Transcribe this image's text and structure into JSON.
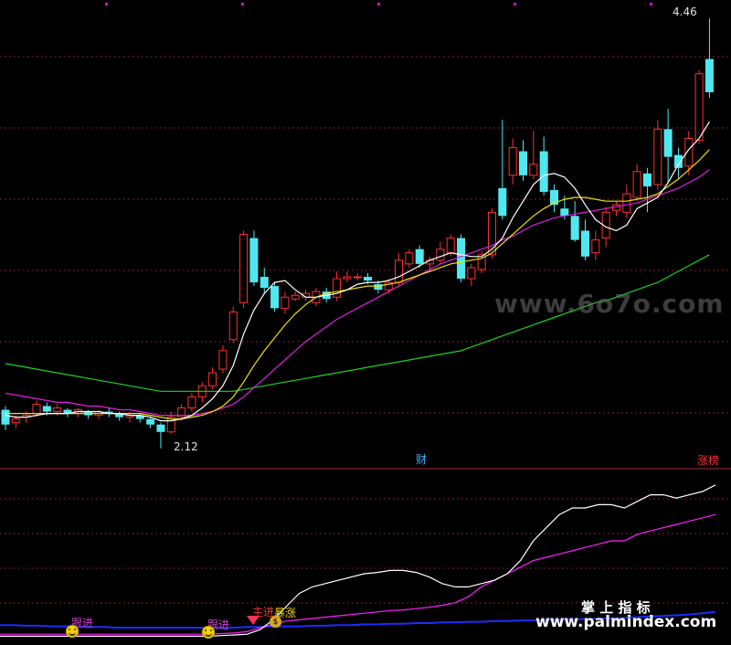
{
  "chart_data": {
    "type": "candlestick",
    "price_high_label": "4.46",
    "price_low_label": "2.12",
    "marker_cai": "财",
    "marker_zhangbang": "涨榜",
    "candles": [
      [
        2.33,
        2.25,
        2.35,
        2.22
      ],
      [
        2.26,
        2.28,
        2.3,
        2.23
      ],
      [
        2.29,
        2.3,
        2.32,
        2.26
      ],
      [
        2.31,
        2.36,
        2.38,
        2.29
      ],
      [
        2.35,
        2.32,
        2.37,
        2.3
      ],
      [
        2.32,
        2.34,
        2.36,
        2.3
      ],
      [
        2.33,
        2.31,
        2.34,
        2.29
      ],
      [
        2.31,
        2.33,
        2.34,
        2.29
      ],
      [
        2.32,
        2.3,
        2.33,
        2.28
      ],
      [
        2.3,
        2.32,
        2.33,
        2.28
      ],
      [
        2.32,
        2.31,
        2.34,
        2.29
      ],
      [
        2.31,
        2.29,
        2.32,
        2.27
      ],
      [
        2.29,
        2.3,
        2.32,
        2.26
      ],
      [
        2.3,
        2.28,
        2.31,
        2.26
      ],
      [
        2.28,
        2.25,
        2.29,
        2.23
      ],
      [
        2.25,
        2.21,
        2.26,
        2.12
      ],
      [
        2.21,
        2.29,
        2.32,
        2.2
      ],
      [
        2.29,
        2.34,
        2.36,
        2.27
      ],
      [
        2.34,
        2.4,
        2.42,
        2.32
      ],
      [
        2.4,
        2.46,
        2.48,
        2.37
      ],
      [
        2.46,
        2.53,
        2.56,
        2.44
      ],
      [
        2.55,
        2.65,
        2.68,
        2.53
      ],
      [
        2.71,
        2.86,
        2.89,
        2.69
      ],
      [
        2.91,
        3.28,
        3.3,
        2.88
      ],
      [
        3.26,
        3.02,
        3.3,
        3.0
      ],
      [
        3.05,
        2.99,
        3.1,
        2.96
      ],
      [
        3.0,
        2.88,
        3.02,
        2.86
      ],
      [
        2.88,
        2.94,
        2.97,
        2.85
      ],
      [
        2.93,
        2.95,
        2.97,
        2.92
      ],
      [
        2.94,
        2.96,
        2.98,
        2.92
      ],
      [
        2.91,
        2.97,
        2.99,
        2.89
      ],
      [
        2.97,
        2.93,
        2.99,
        2.91
      ],
      [
        2.94,
        3.04,
        3.08,
        2.92
      ],
      [
        3.04,
        3.05,
        3.08,
        3.02
      ],
      [
        3.05,
        3.05,
        3.07,
        3.03
      ],
      [
        3.05,
        3.03,
        3.07,
        3.01
      ],
      [
        3.01,
        2.98,
        3.03,
        2.96
      ],
      [
        2.98,
        3.02,
        3.04,
        2.96
      ],
      [
        3.02,
        3.14,
        3.18,
        3.0
      ],
      [
        3.12,
        3.18,
        3.2,
        3.1
      ],
      [
        3.2,
        3.12,
        3.22,
        3.1
      ],
      [
        3.12,
        3.14,
        3.16,
        3.08
      ],
      [
        3.14,
        3.2,
        3.24,
        3.12
      ],
      [
        3.18,
        3.26,
        3.28,
        3.16
      ],
      [
        3.26,
        3.04,
        3.28,
        3.02
      ],
      [
        3.04,
        3.1,
        3.12,
        3.0
      ],
      [
        3.09,
        3.17,
        3.19,
        3.07
      ],
      [
        3.17,
        3.4,
        3.42,
        3.15
      ],
      [
        3.53,
        3.38,
        3.9,
        3.36
      ],
      [
        3.6,
        3.75,
        3.8,
        3.55
      ],
      [
        3.73,
        3.6,
        3.79,
        3.57
      ],
      [
        3.6,
        3.66,
        3.84,
        3.58
      ],
      [
        3.73,
        3.51,
        3.81,
        3.49
      ],
      [
        3.52,
        3.44,
        3.55,
        3.4
      ],
      [
        3.42,
        3.38,
        3.49,
        3.36
      ],
      [
        3.38,
        3.25,
        3.46,
        3.24
      ],
      [
        3.3,
        3.16,
        3.36,
        3.14
      ],
      [
        3.18,
        3.25,
        3.3,
        3.14
      ],
      [
        3.26,
        3.4,
        3.43,
        3.21
      ],
      [
        3.41,
        3.44,
        3.46,
        3.38
      ],
      [
        3.4,
        3.5,
        3.55,
        3.37
      ],
      [
        3.48,
        3.62,
        3.66,
        3.46
      ],
      [
        3.61,
        3.54,
        3.64,
        3.4
      ],
      [
        3.55,
        3.85,
        3.9,
        3.52
      ],
      [
        3.85,
        3.7,
        3.96,
        3.56
      ],
      [
        3.71,
        3.64,
        3.75,
        3.58
      ],
      [
        3.65,
        3.8,
        3.84,
        3.6
      ],
      [
        3.79,
        4.15,
        4.17,
        3.77
      ],
      [
        4.23,
        4.05,
        4.45,
        4.02
      ]
    ],
    "ma_white": [
      2.3,
      2.29,
      2.29,
      2.3,
      2.31,
      2.31,
      2.31,
      2.32,
      2.32,
      2.32,
      2.31,
      2.31,
      2.3,
      2.3,
      2.29,
      2.27,
      2.27,
      2.28,
      2.3,
      2.34,
      2.39,
      2.46,
      2.57,
      2.74,
      2.87,
      2.96,
      3.02,
      3.03,
      2.98,
      2.94,
      2.94,
      2.95,
      2.96,
      2.98,
      3.01,
      3.02,
      3.02,
      3.03,
      3.05,
      3.08,
      3.11,
      3.14,
      3.16,
      3.18,
      3.17,
      3.16,
      3.16,
      3.2,
      3.26,
      3.37,
      3.46,
      3.55,
      3.6,
      3.61,
      3.59,
      3.53,
      3.44,
      3.36,
      3.32,
      3.3,
      3.33,
      3.42,
      3.45,
      3.48,
      3.56,
      3.66,
      3.74,
      3.8,
      3.89
    ],
    "ma_yellow": [
      2.31,
      2.31,
      2.31,
      2.31,
      2.31,
      2.31,
      2.31,
      2.31,
      2.31,
      2.31,
      2.31,
      2.31,
      2.31,
      2.31,
      2.3,
      2.29,
      2.28,
      2.28,
      2.29,
      2.3,
      2.32,
      2.35,
      2.4,
      2.48,
      2.57,
      2.65,
      2.72,
      2.79,
      2.85,
      2.9,
      2.94,
      2.96,
      2.97,
      2.98,
      2.99,
      3.0,
      3.0,
      3.01,
      3.02,
      3.04,
      3.06,
      3.08,
      3.1,
      3.12,
      3.13,
      3.14,
      3.15,
      3.18,
      3.23,
      3.28,
      3.33,
      3.38,
      3.42,
      3.45,
      3.47,
      3.48,
      3.48,
      3.47,
      3.46,
      3.46,
      3.46,
      3.47,
      3.48,
      3.5,
      3.54,
      3.58,
      3.63,
      3.68,
      3.74
    ],
    "ma_magenta": [
      2.42,
      2.41,
      2.4,
      2.39,
      2.38,
      2.37,
      2.37,
      2.36,
      2.35,
      2.35,
      2.34,
      2.33,
      2.33,
      2.32,
      2.31,
      2.3,
      2.3,
      2.3,
      2.3,
      2.31,
      2.32,
      2.34,
      2.36,
      2.4,
      2.45,
      2.5,
      2.55,
      2.6,
      2.65,
      2.7,
      2.74,
      2.78,
      2.82,
      2.85,
      2.88,
      2.91,
      2.94,
      2.97,
      3.0,
      3.03,
      3.06,
      3.09,
      3.12,
      3.14,
      3.16,
      3.18,
      3.2,
      3.22,
      3.25,
      3.27,
      3.3,
      3.33,
      3.35,
      3.37,
      3.38,
      3.39,
      3.4,
      3.41,
      3.42,
      3.43,
      3.44,
      3.45,
      3.47,
      3.49,
      3.51,
      3.53,
      3.56,
      3.59,
      3.63
    ],
    "ma_green": [
      2.58,
      2.57,
      2.56,
      2.55,
      2.54,
      2.53,
      2.52,
      2.51,
      2.5,
      2.49,
      2.48,
      2.47,
      2.46,
      2.45,
      2.44,
      2.43,
      2.43,
      2.43,
      2.43,
      2.43,
      2.43,
      2.43,
      2.43,
      2.44,
      2.45,
      2.46,
      2.47,
      2.48,
      2.49,
      2.5,
      2.51,
      2.52,
      2.53,
      2.54,
      2.55,
      2.56,
      2.57,
      2.58,
      2.59,
      2.6,
      2.61,
      2.62,
      2.63,
      2.64,
      2.65,
      2.67,
      2.69,
      2.71,
      2.73,
      2.75,
      2.77,
      2.79,
      2.81,
      2.83,
      2.85,
      2.87,
      2.89,
      2.91,
      2.92,
      2.94,
      2.96,
      2.98,
      3.0,
      3.02,
      3.05,
      3.08,
      3.11,
      3.14,
      3.17
    ],
    "ylim": [
      2.1,
      4.5
    ],
    "sub_white": [
      0.5,
      0.5,
      0.5,
      0.5,
      0.5,
      0.5,
      0.5,
      0.5,
      0.5,
      0.5,
      0.5,
      0.5,
      0.5,
      0.5,
      0.5,
      0.5,
      0.5,
      0.6,
      0.7,
      0.8,
      1.5,
      3,
      5,
      7,
      8,
      8.5,
      9,
      9.5,
      10,
      10.2,
      10.5,
      10.5,
      10.2,
      9.5,
      8.5,
      8,
      8,
      8.5,
      9,
      10,
      12,
      15,
      17,
      19,
      20,
      20,
      20.5,
      20.5,
      20,
      21,
      22,
      22,
      21.5,
      22,
      22.5,
      23.5
    ],
    "sub_magenta": [
      0.8,
      0.8,
      0.8,
      0.8,
      0.8,
      0.8,
      0.8,
      0.8,
      0.8,
      0.8,
      0.8,
      0.8,
      0.8,
      0.8,
      0.8,
      0.8,
      0.8,
      0.9,
      1.0,
      1.2,
      1.8,
      2.3,
      2.8,
      3.0,
      3.2,
      3.4,
      3.6,
      3.8,
      4.0,
      4.2,
      4.4,
      4.5,
      4.7,
      4.9,
      5.2,
      5.6,
      6.5,
      8,
      9,
      10,
      11,
      12,
      12.5,
      13,
      13.5,
      14,
      14.5,
      15,
      15,
      16,
      16.5,
      17,
      17.5,
      18,
      18.5,
      19
    ],
    "sub_blue": [
      2.2,
      2.2,
      2.1,
      2.1,
      2.0,
      2.0,
      1.9,
      1.9,
      1.9,
      1.8,
      1.8,
      1.8,
      1.8,
      1.8,
      1.8,
      1.8,
      1.8,
      1.8,
      1.8,
      1.9,
      1.9,
      2.0,
      2.0,
      2.0,
      2.1,
      2.1,
      2.2,
      2.2,
      2.3,
      2.3,
      2.4,
      2.4,
      2.5,
      2.5,
      2.6,
      2.6,
      2.7,
      2.7,
      2.8,
      2.8,
      2.9,
      2.9,
      3.0,
      3.0,
      3.1,
      3.1,
      3.2,
      3.2,
      3.3,
      3.4,
      3.5,
      3.6,
      3.7,
      3.8,
      4.0,
      4.2
    ],
    "sub_ylim": [
      0,
      25
    ],
    "signal_labels": {
      "gen_jin_1": "跟进",
      "gen_jin_2": "跟进",
      "zhu_li": "主进",
      "bao_zhang": "暴涨"
    }
  },
  "watermark_top": "www.6o7o.com",
  "watermark_cn": "掌 上 指 标",
  "watermark_url": "www.palmindex.com",
  "colors": {
    "up": "#ff3030",
    "down": "#50e8f0",
    "grid": "#7f1f2a",
    "bg": "#000000"
  }
}
